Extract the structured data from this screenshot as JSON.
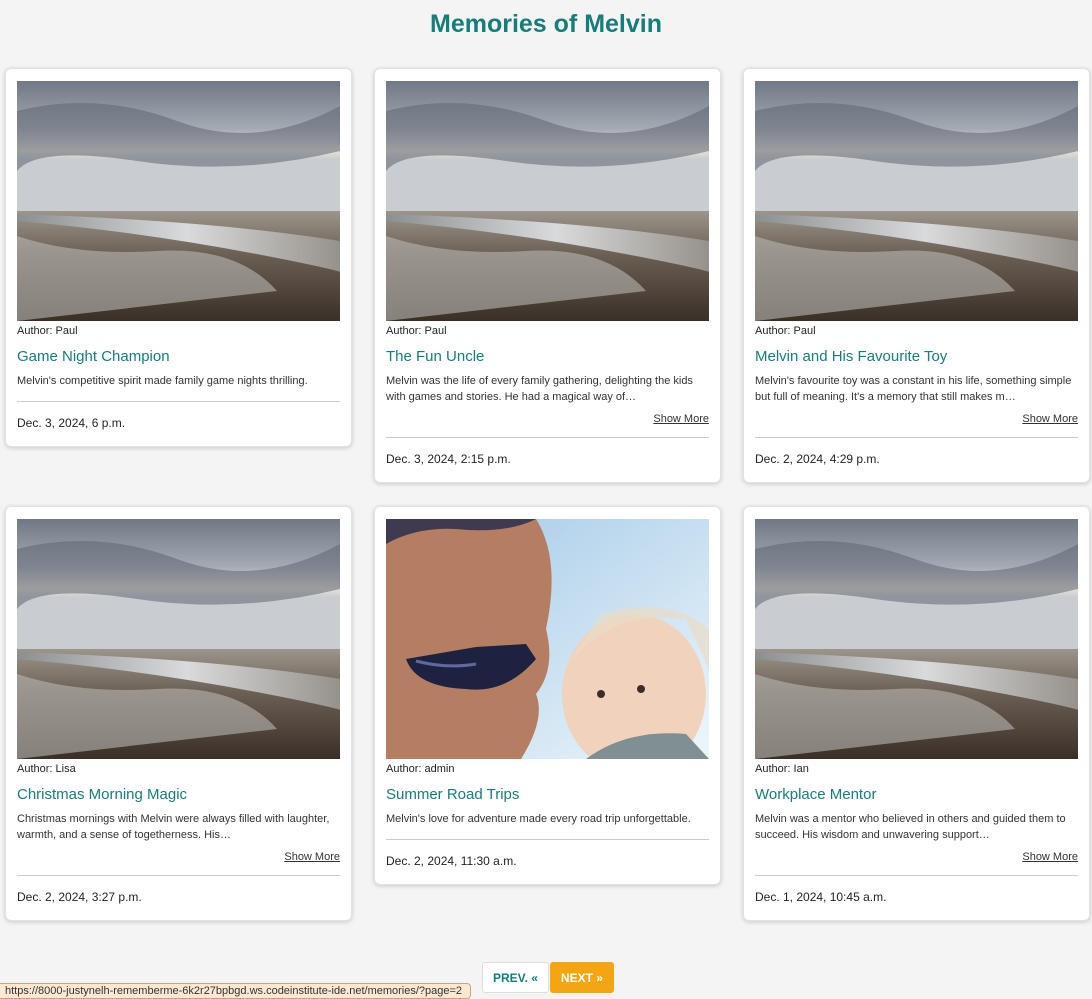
{
  "page": {
    "title": "Memories of Melvin"
  },
  "memories": [
    {
      "author": "Author: Paul",
      "title": "Game Night Champion",
      "excerpt": "Melvin's competitive spirit made family game nights thrilling.",
      "show_more": "",
      "date": "Dec. 3, 2024, 6 p.m.",
      "photo": "beach-landscape"
    },
    {
      "author": "Author: Paul",
      "title": "The Fun Uncle",
      "excerpt": "Melvin was the life of every family gathering, delighting the kids with games and stories. He had a magical way of…",
      "show_more": "Show More",
      "date": "Dec. 3, 2024, 2:15 p.m.",
      "photo": "beach-landscape"
    },
    {
      "author": "Author: Paul",
      "title": "Melvin and His Favourite Toy",
      "excerpt": "Melvin's favourite toy was a constant in his life, something simple but full of meaning. It's a memory that still makes m…",
      "show_more": "Show More",
      "date": "Dec. 2, 2024, 4:29 p.m.",
      "photo": "beach-landscape"
    },
    {
      "author": "Author: Lisa",
      "title": "Christmas Morning Magic",
      "excerpt": "Christmas mornings with Melvin were always filled with laughter, warmth, and a sense of togetherness. His…",
      "show_more": "Show More",
      "date": "Dec. 2, 2024, 3:27 p.m.",
      "photo": "beach-landscape"
    },
    {
      "author": "Author: admin",
      "title": "Summer Road Trips",
      "excerpt": "Melvin's love for adventure made every road trip unforgettable.",
      "show_more": "",
      "date": "Dec. 2, 2024, 11:30 a.m.",
      "photo": "man-and-baby-portrait"
    },
    {
      "author": "Author: Ian",
      "title": "Workplace Mentor",
      "excerpt": "Melvin was a mentor who believed in others and guided them to succeed. His wisdom and unwavering support…",
      "show_more": "Show More",
      "date": "Dec. 1, 2024, 10:45 a.m.",
      "photo": "beach-landscape"
    }
  ],
  "pagination": {
    "prev_label": "PREV. «",
    "next_label": "NEXT »"
  },
  "status_bar": {
    "url": "https://8000-justynelh-rememberme-6k2r27bpbgd.ws.codeinstitute-ide.net/memories/?page=2"
  },
  "colors": {
    "accent": "#157e7a",
    "next_button": "#f4a512",
    "background": "#f4f4f4"
  }
}
